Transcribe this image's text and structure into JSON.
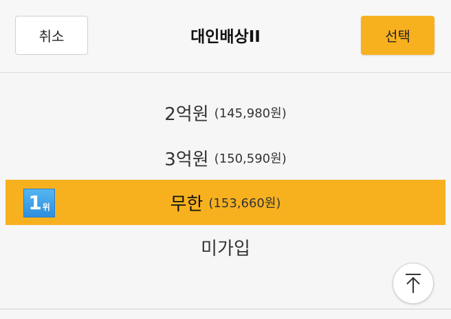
{
  "header": {
    "cancel_label": "취소",
    "title": "대인배상II",
    "select_label": "선택"
  },
  "options": [
    {
      "label": "2억원",
      "price": "(145,980원)",
      "selected": false
    },
    {
      "label": "3억원",
      "price": "(150,590원)",
      "selected": false
    },
    {
      "label": "무한",
      "price": "(153,660원)",
      "selected": true,
      "rank": {
        "number": "1",
        "suffix": "위"
      }
    },
    {
      "label": "미가입",
      "price": "",
      "selected": false
    }
  ],
  "colors": {
    "accent": "#f7b11f",
    "badge": "#3a9be6",
    "background": "#f6f6f6"
  },
  "icons": {
    "scroll_top": "arrow-up-to-top-icon"
  }
}
